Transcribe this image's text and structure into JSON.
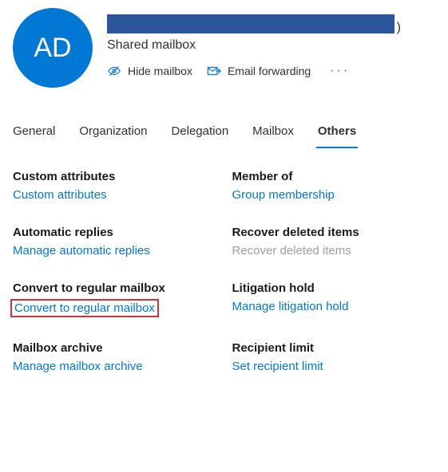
{
  "header": {
    "avatar_initials": "AD",
    "mailbox_type": "Shared mailbox",
    "actions": {
      "hide_mailbox": "Hide mailbox",
      "email_forwarding": "Email forwarding"
    }
  },
  "tabs": [
    {
      "label": "General"
    },
    {
      "label": "Organization"
    },
    {
      "label": "Delegation"
    },
    {
      "label": "Mailbox"
    },
    {
      "label": "Others"
    }
  ],
  "active_tab_index": 4,
  "sections": {
    "left": [
      {
        "title": "Custom attributes",
        "link": "Custom attributes",
        "highlighted": false,
        "disabled": false
      },
      {
        "title": "Automatic replies",
        "link": "Manage automatic replies",
        "highlighted": false,
        "disabled": false
      },
      {
        "title": "Convert to regular mailbox",
        "link": "Convert to regular mailbox",
        "highlighted": true,
        "disabled": false
      },
      {
        "title": "Mailbox archive",
        "link": "Manage mailbox archive",
        "highlighted": false,
        "disabled": false
      }
    ],
    "right": [
      {
        "title": "Member of",
        "link": "Group membership",
        "highlighted": false,
        "disabled": false
      },
      {
        "title": "Recover deleted items",
        "link": "Recover deleted items",
        "highlighted": false,
        "disabled": true
      },
      {
        "title": "Litigation hold",
        "link": "Manage litigation hold",
        "highlighted": false,
        "disabled": false
      },
      {
        "title": "Recipient limit",
        "link": "Set recipient limit",
        "highlighted": false,
        "disabled": false
      }
    ]
  },
  "colors": {
    "primary": "#0078d4",
    "highlight_border": "#d13438"
  }
}
